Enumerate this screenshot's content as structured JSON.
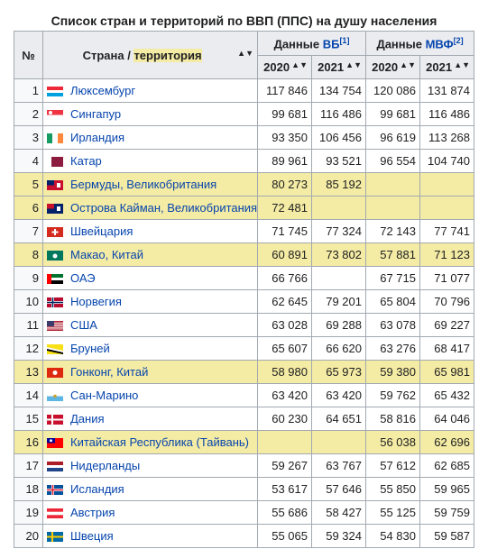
{
  "caption": "Список стран и территорий по ВВП (ППС) на душу населения",
  "headers": {
    "rank": "№",
    "country_prefix": "Страна / ",
    "country_territory": "территория",
    "wb_prefix": "Данные ",
    "wb_link": "ВБ",
    "wb_ref": "[1]",
    "imf_prefix": "Данные ",
    "imf_link": "МВФ",
    "imf_ref": "[2]",
    "y2020": "2020",
    "y2021": "2021",
    "sort_glyph": "▲▼"
  },
  "rows": [
    {
      "rank": "1",
      "name": "Люксембург",
      "wb2020": "117 846",
      "wb2021": "134 754",
      "imf2020": "120 086",
      "imf2021": "131 874",
      "highlight": false,
      "flag": "luxembourg"
    },
    {
      "rank": "2",
      "name": "Сингапур",
      "wb2020": "99 681",
      "wb2021": "116 486",
      "imf2020": "99 681",
      "imf2021": "116 486",
      "highlight": false,
      "flag": "singapore"
    },
    {
      "rank": "3",
      "name": "Ирландия",
      "wb2020": "93 350",
      "wb2021": "106 456",
      "imf2020": "96 619",
      "imf2021": "113 268",
      "highlight": false,
      "flag": "ireland"
    },
    {
      "rank": "4",
      "name": "Катар",
      "wb2020": "89 961",
      "wb2021": "93 521",
      "imf2020": "96 554",
      "imf2021": "104 740",
      "highlight": false,
      "flag": "qatar"
    },
    {
      "rank": "5",
      "name": "Бермуды, Великобритания",
      "wb2020": "80 273",
      "wb2021": "85 192",
      "imf2020": "",
      "imf2021": "",
      "highlight": true,
      "flag": "bermuda"
    },
    {
      "rank": "6",
      "name": "Острова Кайман, Великобритания",
      "wb2020": "72 481",
      "wb2021": "",
      "imf2020": "",
      "imf2021": "",
      "highlight": true,
      "flag": "cayman"
    },
    {
      "rank": "7",
      "name": "Швейцария",
      "wb2020": "71 745",
      "wb2021": "77 324",
      "imf2020": "72 143",
      "imf2021": "77 741",
      "highlight": false,
      "flag": "switzerland"
    },
    {
      "rank": "8",
      "name": "Макао, Китай",
      "wb2020": "60 891",
      "wb2021": "73 802",
      "imf2020": "57 881",
      "imf2021": "71 123",
      "highlight": true,
      "flag": "macao"
    },
    {
      "rank": "9",
      "name": "ОАЭ",
      "wb2020": "66 766",
      "wb2021": "",
      "imf2020": "67 715",
      "imf2021": "71 077",
      "highlight": false,
      "flag": "uae"
    },
    {
      "rank": "10",
      "name": "Норвегия",
      "wb2020": "62 645",
      "wb2021": "79 201",
      "imf2020": "65 804",
      "imf2021": "70 796",
      "highlight": false,
      "flag": "norway"
    },
    {
      "rank": "11",
      "name": "США",
      "wb2020": "63 028",
      "wb2021": "69 288",
      "imf2020": "63 078",
      "imf2021": "69 227",
      "highlight": false,
      "flag": "usa"
    },
    {
      "rank": "12",
      "name": "Бруней",
      "wb2020": "65 607",
      "wb2021": "66 620",
      "imf2020": "63 276",
      "imf2021": "68 417",
      "highlight": false,
      "flag": "brunei"
    },
    {
      "rank": "13",
      "name": "Гонконг, Китай",
      "wb2020": "58 980",
      "wb2021": "65 973",
      "imf2020": "59 380",
      "imf2021": "65 981",
      "highlight": true,
      "flag": "hongkong"
    },
    {
      "rank": "14",
      "name": "Сан-Марино",
      "wb2020": "63 420",
      "wb2021": "63 420",
      "imf2020": "59 762",
      "imf2021": "65 432",
      "highlight": false,
      "flag": "sanmarino"
    },
    {
      "rank": "15",
      "name": "Дания",
      "wb2020": "60 230",
      "wb2021": "64 651",
      "imf2020": "58 816",
      "imf2021": "64 046",
      "highlight": false,
      "flag": "denmark"
    },
    {
      "rank": "16",
      "name": "Китайская Республика (Тайвань)",
      "wb2020": "",
      "wb2021": "",
      "imf2020": "56 038",
      "imf2021": "62 696",
      "highlight": true,
      "flag": "taiwan"
    },
    {
      "rank": "17",
      "name": "Нидерланды",
      "wb2020": "59 267",
      "wb2021": "63 767",
      "imf2020": "57 612",
      "imf2021": "62 685",
      "highlight": false,
      "flag": "netherlands"
    },
    {
      "rank": "18",
      "name": "Исландия",
      "wb2020": "53 617",
      "wb2021": "57 646",
      "imf2020": "55 850",
      "imf2021": "59 965",
      "highlight": false,
      "flag": "iceland"
    },
    {
      "rank": "19",
      "name": "Австрия",
      "wb2020": "55 686",
      "wb2021": "58 427",
      "imf2020": "55 125",
      "imf2021": "59 759",
      "highlight": false,
      "flag": "austria"
    },
    {
      "rank": "20",
      "name": "Швеция",
      "wb2020": "55 065",
      "wb2021": "59 324",
      "imf2020": "54 830",
      "imf2021": "59 587",
      "highlight": false,
      "flag": "sweden"
    }
  ]
}
